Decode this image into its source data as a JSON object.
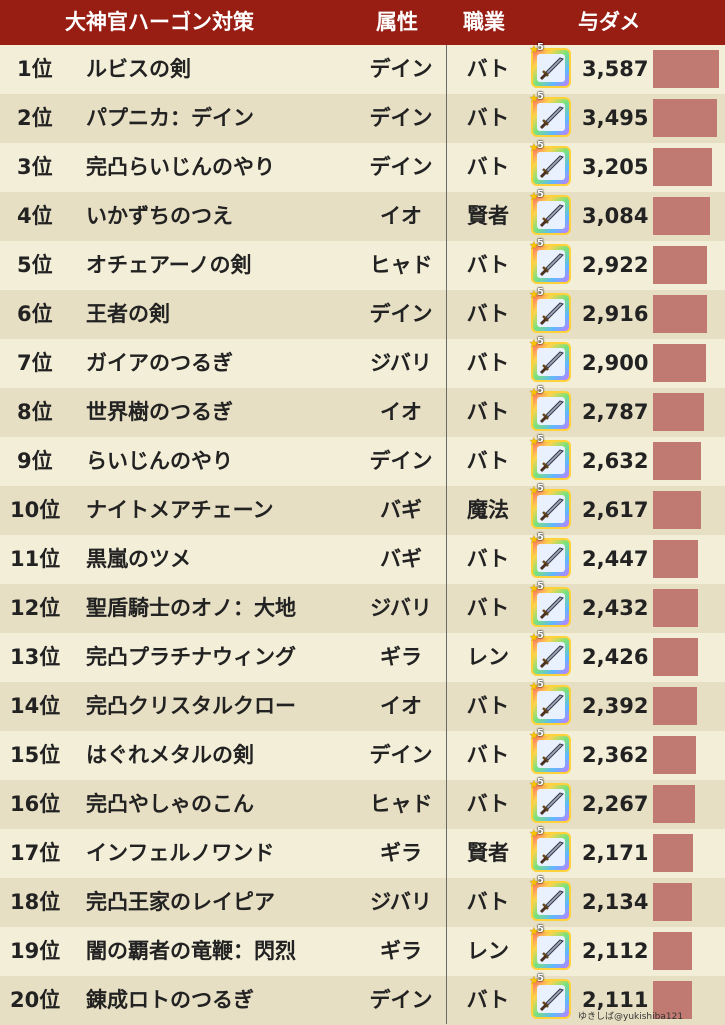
{
  "header": {
    "title": "大神官ハーゴン対策",
    "attribute": "属性",
    "job": "職業",
    "damage": "与ダメ"
  },
  "credit": "ゆきしば@yukishiba121",
  "chart_data": {
    "type": "bar",
    "title": "大神官ハーゴン対策",
    "columns": [
      "",
      "",
      "属性",
      "職業",
      "",
      "与ダメ"
    ],
    "bar_color": "#c07a72",
    "header_color": "#981e14",
    "max_value": 3587,
    "rows": [
      {
        "rank": "1位",
        "name": "ルビスの剣",
        "attr": "デイン",
        "job": "バト",
        "stars": "5",
        "value": 3587,
        "value_label": "3,587"
      },
      {
        "rank": "2位",
        "name": "パプニカ：デイン",
        "attr": "デイン",
        "job": "バト",
        "stars": "5",
        "value": 3495,
        "value_label": "3,495"
      },
      {
        "rank": "3位",
        "name": "完凸らいじんのやり",
        "attr": "デイン",
        "job": "バト",
        "stars": "5",
        "value": 3205,
        "value_label": "3,205"
      },
      {
        "rank": "4位",
        "name": "いかずちのつえ",
        "attr": "イオ",
        "job": "賢者",
        "stars": "5",
        "value": 3084,
        "value_label": "3,084"
      },
      {
        "rank": "5位",
        "name": "オチェアーノの剣",
        "attr": "ヒャド",
        "job": "バト",
        "stars": "5",
        "value": 2922,
        "value_label": "2,922"
      },
      {
        "rank": "6位",
        "name": "王者の剣",
        "attr": "デイン",
        "job": "バト",
        "stars": "5",
        "value": 2916,
        "value_label": "2,916"
      },
      {
        "rank": "7位",
        "name": "ガイアのつるぎ",
        "attr": "ジバリ",
        "job": "バト",
        "stars": "5",
        "value": 2900,
        "value_label": "2,900"
      },
      {
        "rank": "8位",
        "name": "世界樹のつるぎ",
        "attr": "イオ",
        "job": "バト",
        "stars": "5",
        "value": 2787,
        "value_label": "2,787"
      },
      {
        "rank": "9位",
        "name": "らいじんのやり",
        "attr": "デイン",
        "job": "バト",
        "stars": "5",
        "value": 2632,
        "value_label": "2,632"
      },
      {
        "rank": "10位",
        "name": "ナイトメアチェーン",
        "attr": "バギ",
        "job": "魔法",
        "stars": "5",
        "value": 2617,
        "value_label": "2,617"
      },
      {
        "rank": "11位",
        "name": "黒嵐のツメ",
        "attr": "バギ",
        "job": "バト",
        "stars": "5",
        "value": 2447,
        "value_label": "2,447"
      },
      {
        "rank": "12位",
        "name": "聖盾騎士のオノ：大地",
        "attr": "ジバリ",
        "job": "バト",
        "stars": "5",
        "value": 2432,
        "value_label": "2,432"
      },
      {
        "rank": "13位",
        "name": "完凸プラチナウィング",
        "attr": "ギラ",
        "job": "レン",
        "stars": "5",
        "value": 2426,
        "value_label": "2,426"
      },
      {
        "rank": "14位",
        "name": "完凸クリスタルクロー",
        "attr": "イオ",
        "job": "バト",
        "stars": "5",
        "value": 2392,
        "value_label": "2,392"
      },
      {
        "rank": "15位",
        "name": "はぐれメタルの剣",
        "attr": "デイン",
        "job": "バト",
        "stars": "5",
        "value": 2362,
        "value_label": "2,362"
      },
      {
        "rank": "16位",
        "name": "完凸やしゃのこん",
        "attr": "ヒャド",
        "job": "バト",
        "stars": "5",
        "value": 2267,
        "value_label": "2,267"
      },
      {
        "rank": "17位",
        "name": "インフェルノワンド",
        "attr": "ギラ",
        "job": "賢者",
        "stars": "5",
        "value": 2171,
        "value_label": "2,171"
      },
      {
        "rank": "18位",
        "name": "完凸王家のレイピア",
        "attr": "ジバリ",
        "job": "バト",
        "stars": "5",
        "value": 2134,
        "value_label": "2,134"
      },
      {
        "rank": "19位",
        "name": "闇の覇者の竜鞭：閃烈",
        "attr": "ギラ",
        "job": "レン",
        "stars": "5",
        "value": 2112,
        "value_label": "2,112"
      },
      {
        "rank": "20位",
        "name": "錬成ロトのつるぎ",
        "attr": "デイン",
        "job": "バト",
        "stars": "5",
        "value": 2111,
        "value_label": "2,111"
      }
    ]
  }
}
